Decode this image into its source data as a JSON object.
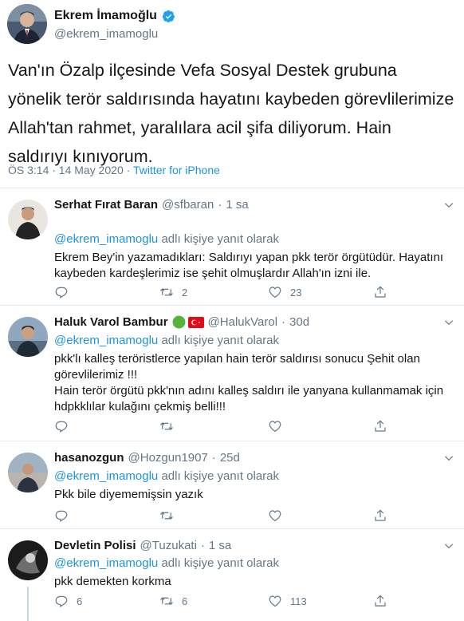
{
  "main": {
    "name": "Ekrem İmamoğlu",
    "handle": "@ekrem_imamoglu",
    "text": "Van'ın Özalp ilçesinde Vefa Sosyal Destek grubuna yönelik terör saldırısında hayatını kaybeden görevlilerimize Allah'tan rahmet, yaralılara acil şifa diliyorum. Hain saldırıyı kınıyorum.",
    "time": "ÖS 3:14 · 14 May 2020 · ",
    "client": "Twitter for iPhone"
  },
  "reply_to_suffix": " adlı kişiye yanıt olarak",
  "replies": [
    {
      "name": "Serhat Fırat Baran",
      "handle": "@sfbaran",
      "dot": "·",
      "time": "1 sa",
      "mention": "@ekrem_imamoglu",
      "text": "Ekrem Bey'in yazamadıkları: Saldırıyı yapan pkk terör örgütüdür. Hayatını kaybeden kardeşlerimiz ise şehit olmuşlardır Allah'ın izni ile.",
      "reply_count": "",
      "retweet_count": "2",
      "like_count": "23"
    },
    {
      "name": "Haluk Varol Bambur",
      "handle": "@HalukVarol",
      "dot": "·",
      "time": "30d",
      "mention": "@ekrem_imamoglu",
      "text": "pkk'lı kalleş teröristlerce yapılan hain terör saldırısı sonucu Şehit olan görevlilerimiz !!!\nHain terör örgütü  pkk'nın adını kalleş saldırı ile yanyana kullanmamak için hdpkklılar kulağını çekmiş belli!!!",
      "reply_count": "",
      "retweet_count": "",
      "like_count": ""
    },
    {
      "name": "hasanozgun",
      "handle": "@Hozgun1907",
      "dot": "·",
      "time": "25d",
      "mention": "@ekrem_imamoglu",
      "text": "Pkk bile diyememişsin yazık",
      "reply_count": "",
      "retweet_count": "",
      "like_count": ""
    },
    {
      "name": "Devletin Polisi",
      "handle": "@Tuzukati",
      "dot": "·",
      "time": "1 sa",
      "mention": "@ekrem_imamoglu",
      "text": "pkk demekten korkma",
      "reply_count": "6",
      "retweet_count": "6",
      "like_count": "113"
    }
  ],
  "icons": {
    "verified": "verified-badge-icon",
    "reply": "reply-icon",
    "retweet": "retweet-icon",
    "like": "heart-icon",
    "share": "share-icon",
    "more": "chevron-down-icon"
  },
  "colors": {
    "accent": "#1da1f2",
    "link": "#1b95e0",
    "muted": "#657786",
    "text": "#14171a",
    "divider": "#e6ecf0"
  }
}
